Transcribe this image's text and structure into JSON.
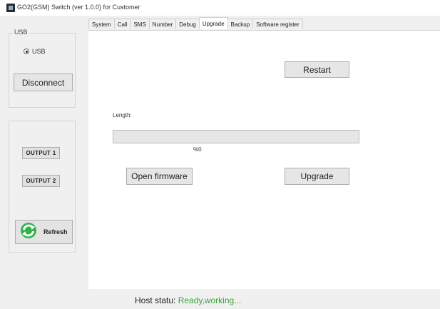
{
  "window": {
    "title": "GO2(GSM) Switch (ver 1.0.0) for Customer"
  },
  "left_panel": {
    "usb_group": {
      "legend": "USB",
      "radio_label": "USB",
      "radio_selected": true,
      "disconnect_label": "Disconnect"
    },
    "outputs": {
      "output1_label": "OUTPUT 1",
      "output2_label": "OUTPUT 2"
    },
    "refresh_label": "Refresh",
    "refresh_icon": "refresh-arrows-icon"
  },
  "tabs": [
    {
      "label": "System"
    },
    {
      "label": "Call"
    },
    {
      "label": "SMS"
    },
    {
      "label": "Number"
    },
    {
      "label": "Debug"
    },
    {
      "label": "Upgrade",
      "active": true
    },
    {
      "label": "Backup"
    },
    {
      "label": "Software register"
    }
  ],
  "upgrade": {
    "restart_label": "Restart",
    "length_label": "Length:",
    "progress_percent": 0,
    "progress_text": "%0",
    "open_firmware_label": "Open firmware",
    "upgrade_label": "Upgrade"
  },
  "status_bar": {
    "label": "Host statu:",
    "value": "Ready,working..."
  },
  "colors": {
    "status_value": "#3aa03a",
    "refresh_icon": "#2fb34a",
    "progress_fill": "#06b025"
  }
}
